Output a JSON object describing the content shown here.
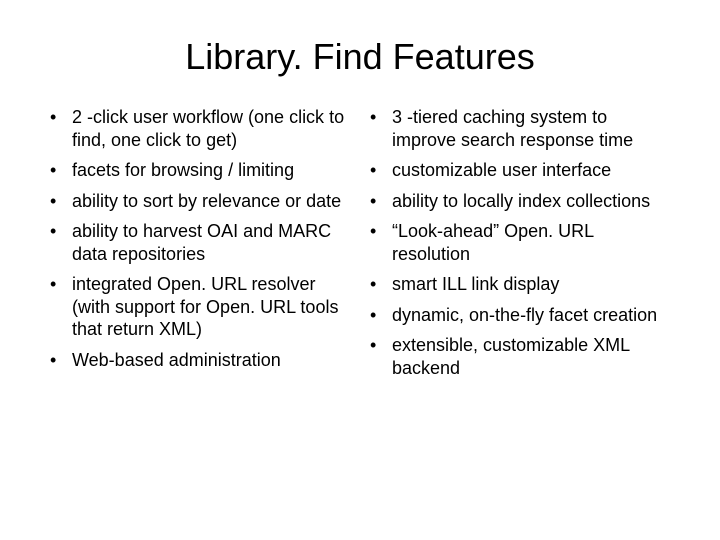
{
  "title": "Library. Find Features",
  "left_column": [
    "2 -click user workflow (one click to find, one click to get)",
    "facets for browsing / limiting",
    "ability to sort by relevance or date",
    "ability to harvest OAI and MARC data repositories",
    "integrated Open. URL resolver (with support for Open. URL tools that return XML)",
    "Web-based administration"
  ],
  "right_column": [
    "3 -tiered caching system to improve search response time",
    "customizable user interface",
    "ability to locally index collections",
    "“Look-ahead” Open. URL resolution",
    "smart ILL link display",
    "dynamic, on-the-fly facet creation",
    "extensible, customizable XML backend"
  ]
}
